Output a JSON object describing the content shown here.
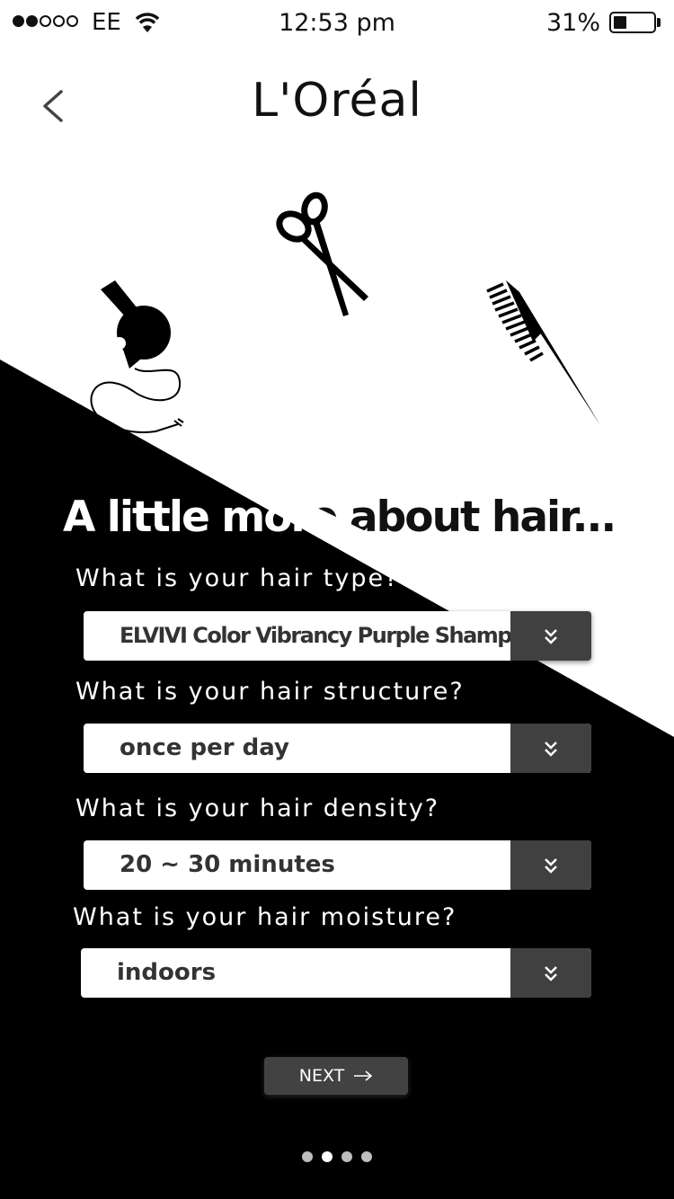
{
  "status_bar": {
    "carrier": "EE",
    "time": "12:53 pm",
    "battery": "31%",
    "signal_bars": 2,
    "signal_total": 5
  },
  "header": {
    "title": "L'Oréal"
  },
  "icons": [
    "chevron-left-icon",
    "scissors-icon",
    "hair-dryer-icon",
    "comb-icon"
  ],
  "form": {
    "heading": "A little more about hair...",
    "fields": [
      {
        "question": "What is your hair type?",
        "value": "ELVIVI Color Vibrancy Purple Shampoo"
      },
      {
        "question": "What is your hair structure?",
        "value": "once per day"
      },
      {
        "question": "What is your hair density?",
        "value": "20 ~ 30 minutes"
      },
      {
        "question": "What is your hair moisture?",
        "value": "indoors"
      }
    ],
    "next_label": "NEXT"
  },
  "pager": {
    "count": 4,
    "active": 1
  },
  "colors": {
    "dark": "#000000",
    "panel": "#404040",
    "light": "#ffffff"
  }
}
